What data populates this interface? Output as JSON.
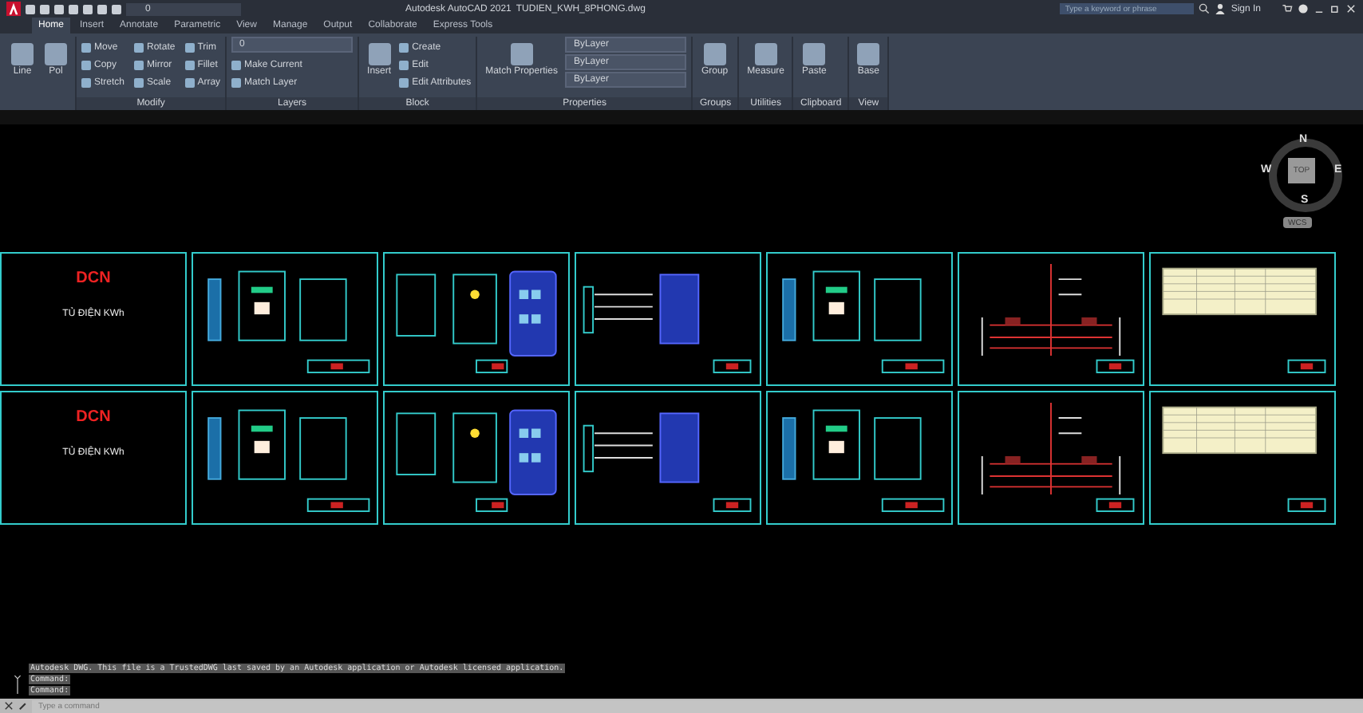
{
  "title_bar": {
    "qat_layer": "0",
    "app_title": "Autodesk AutoCAD 2021",
    "file_name": "TUDIEN_KWH_8PHONG.dwg",
    "search": {
      "placeholder": "Type a keyword or phrase"
    },
    "sign_in": "Sign In"
  },
  "ribbon_tabs": [
    {
      "label": "Home",
      "selected": true
    },
    {
      "label": "Insert",
      "selected": false
    },
    {
      "label": "Annotate",
      "selected": false
    },
    {
      "label": "Parametric",
      "selected": false
    },
    {
      "label": "View",
      "selected": false
    },
    {
      "label": "Manage",
      "selected": false
    },
    {
      "label": "Output",
      "selected": false
    },
    {
      "label": "Collaborate",
      "selected": false
    },
    {
      "label": "Express Tools",
      "selected": false
    }
  ],
  "panels": [
    {
      "large": [
        "Line",
        "Pol"
      ]
    },
    {
      "label": "Modify",
      "small": [
        "Move",
        "Copy",
        "Stretch",
        "Rotate",
        "Mirror",
        "Scale",
        "Trim",
        "Fillet",
        "Array"
      ]
    },
    {
      "label": "Layers",
      "dropdowns": [
        "0"
      ],
      "small": [
        "Make Current",
        "Match Layer"
      ]
    },
    {
      "label": "Block",
      "large": [
        "Insert"
      ],
      "small": [
        "Create",
        "Edit",
        "Edit Attributes"
      ]
    },
    {
      "label": "Properties",
      "large": [
        "Match Properties"
      ],
      "dropdowns": [
        "ByLayer",
        "ByLayer",
        "ByLayer"
      ]
    },
    {
      "label": "Groups",
      "large": [
        "Group"
      ]
    },
    {
      "label": "Utilities",
      "large": [
        "Measure"
      ]
    },
    {
      "label": "Clipboard",
      "large": [
        "Paste"
      ]
    },
    {
      "label": "View",
      "large": [
        "Base"
      ]
    }
  ],
  "viewcube": {
    "north": "N",
    "south": "S",
    "east": "E",
    "west": "W",
    "face": "TOP",
    "ucs": "WCS"
  },
  "sheet_rows": [
    [
      {
        "kind": "cover",
        "logo": "DCN",
        "title": "TỦ ĐIỆN KWh"
      },
      {
        "kind": "panel"
      },
      {
        "kind": "meters"
      },
      {
        "kind": "wiring"
      },
      {
        "kind": "panel"
      },
      {
        "kind": "schematic"
      },
      {
        "kind": "table"
      }
    ],
    [
      {
        "kind": "cover",
        "logo": "DCN",
        "title": "TỦ ĐIỆN KWh"
      },
      {
        "kind": "panel"
      },
      {
        "kind": "meters"
      },
      {
        "kind": "wiring"
      },
      {
        "kind": "panel"
      },
      {
        "kind": "schematic"
      },
      {
        "kind": "table"
      }
    ]
  ],
  "command_line": {
    "history": [
      "Autodesk DWG.  This file is a TrustedDWG last saved by an Autodesk application or Autodesk licensed application.",
      "Command:",
      "Command:"
    ],
    "placeholder": "Type a command"
  }
}
